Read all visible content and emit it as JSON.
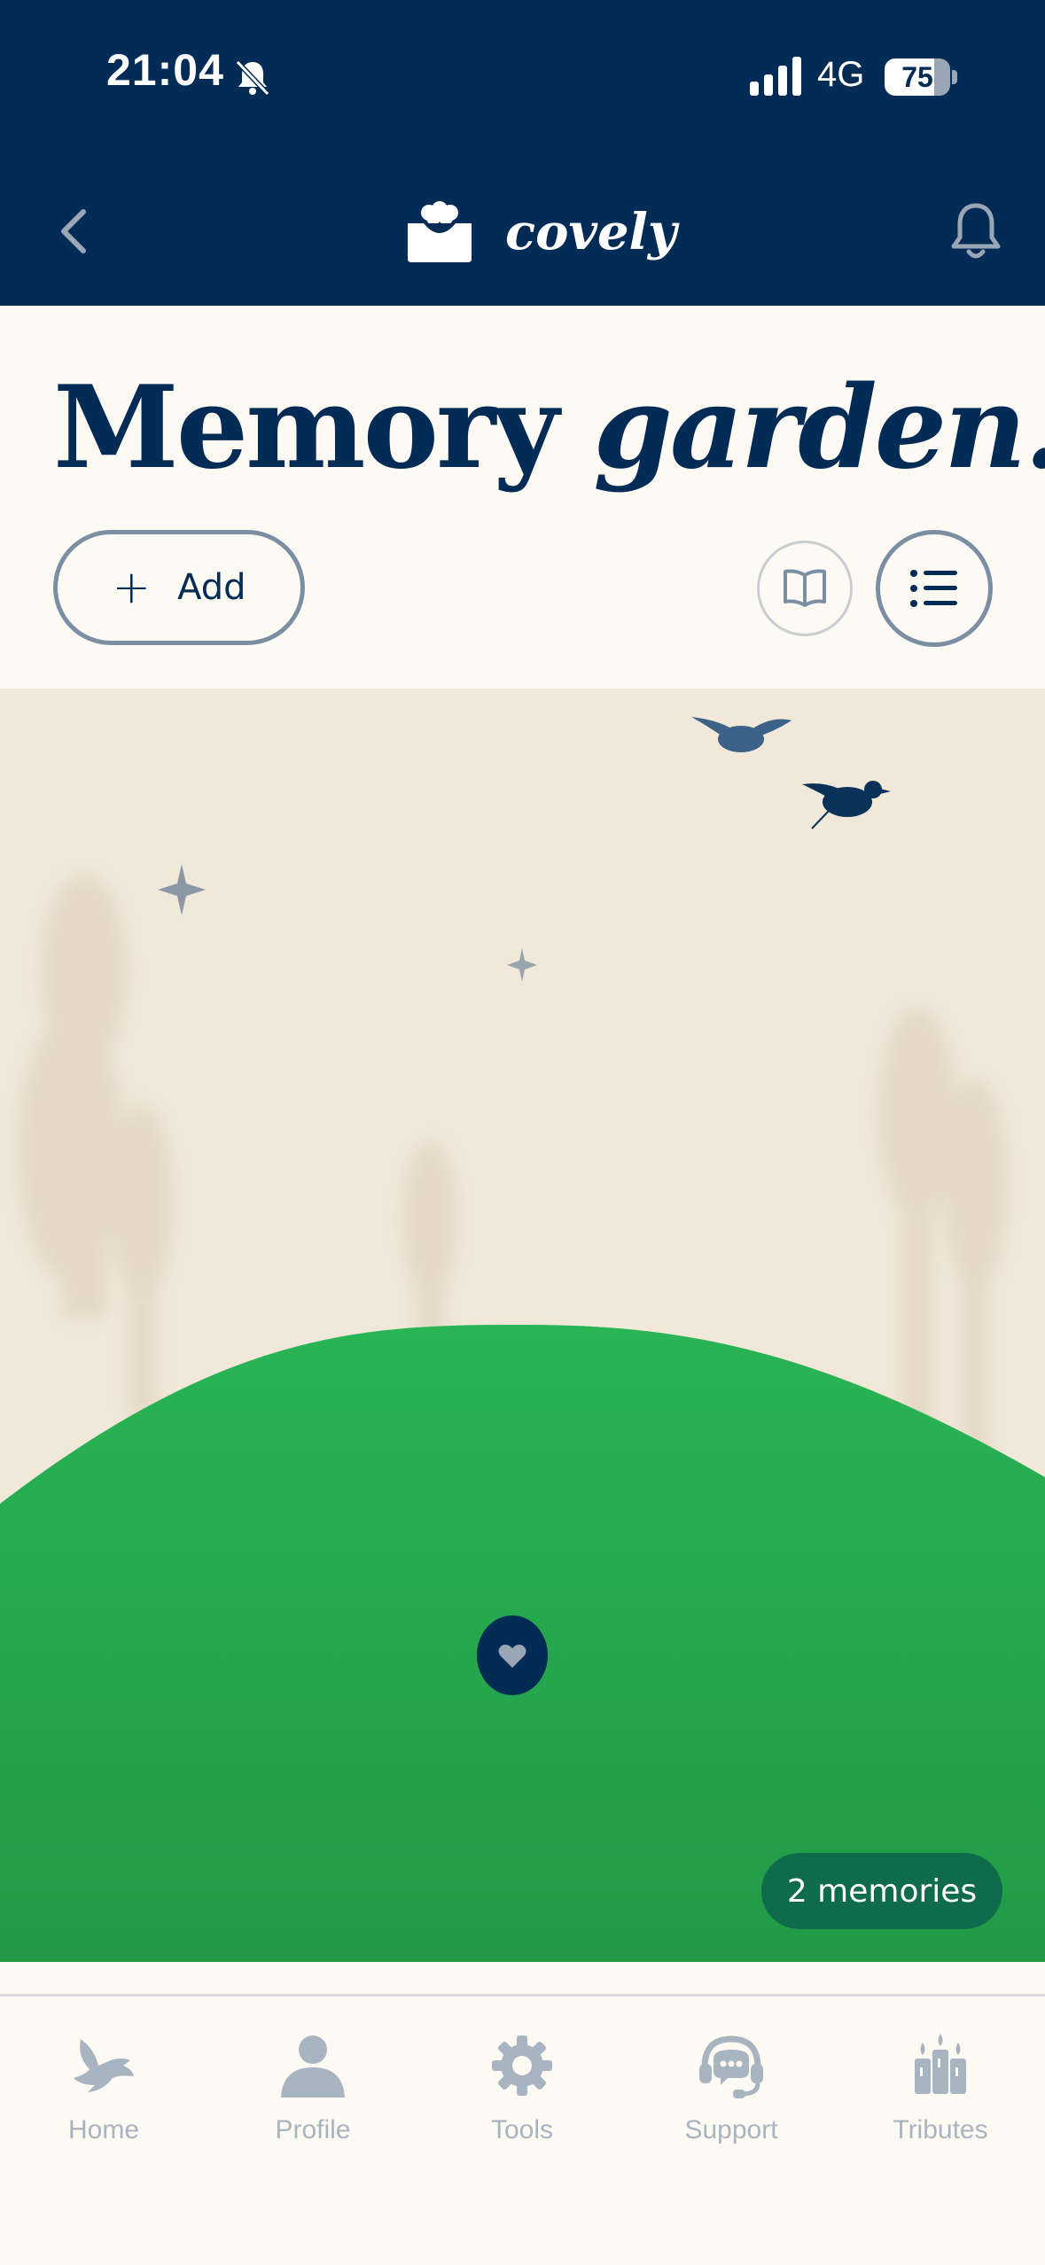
{
  "status": {
    "time": "21:04",
    "network": "4G",
    "battery": "75",
    "battery_fraction": 0.75
  },
  "header": {
    "brand": "covely"
  },
  "page": {
    "title_plain": "Memory ",
    "title_emphasis": "garden."
  },
  "actions": {
    "add_label": "Add"
  },
  "scene": {
    "memories_badge": "2 memories"
  },
  "colors": {
    "navy": "#022b56",
    "grass": "#27ae52",
    "cream": "#fdf9f3",
    "badge": "#0e6b4b"
  },
  "nav": {
    "items": [
      {
        "label": "Home",
        "icon": "dove-icon"
      },
      {
        "label": "Profile",
        "icon": "person-icon"
      },
      {
        "label": "Tools",
        "icon": "gear-icon"
      },
      {
        "label": "Support",
        "icon": "support-headset-icon"
      },
      {
        "label": "Tributes",
        "icon": "candles-icon"
      }
    ]
  }
}
